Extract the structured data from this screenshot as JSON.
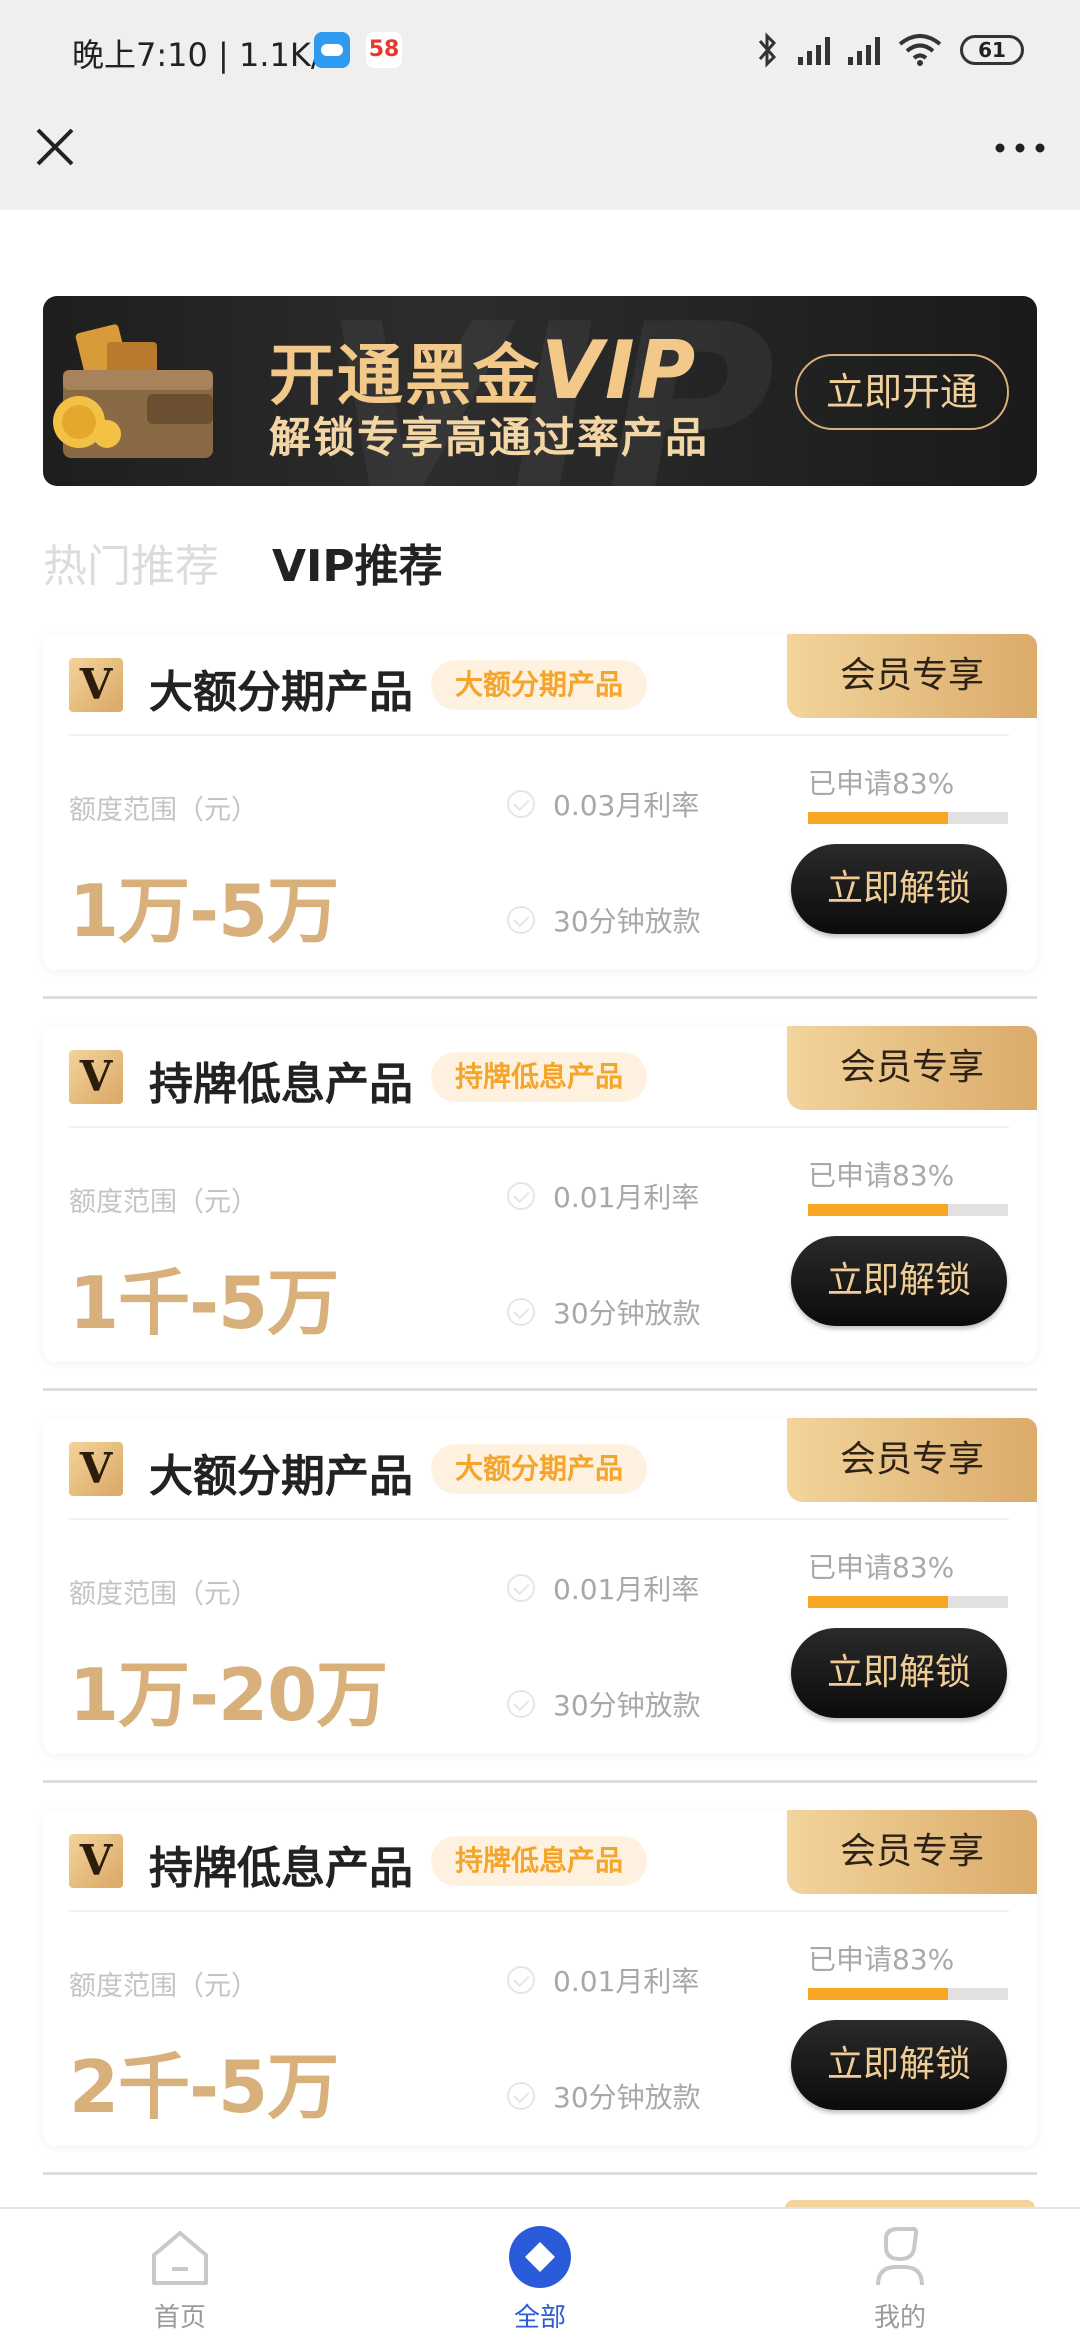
{
  "status_bar": {
    "time_speed": "晚上7:10 | 1.1K/s",
    "app_badge": "58",
    "battery": "61"
  },
  "banner": {
    "title": "开通黑金",
    "title_vip": "VIP",
    "subtitle": "解锁专享高通过率产品",
    "button": "立即开通",
    "watermark": "VIP VIP"
  },
  "tabs": [
    {
      "label": "热门推荐",
      "active": false
    },
    {
      "label": "VIP推荐",
      "active": true
    }
  ],
  "cards": [
    {
      "badge": "V",
      "title": "大额分期产品",
      "tag": "大额分期产品",
      "member": "会员专享",
      "range_label": "额度范围（元）",
      "amount": "1万-5万",
      "rate": "0.03月利率",
      "loan_time": "30分钟放款",
      "applied": "已申请83%",
      "applied_fraction": 0.7,
      "button": "立即解锁"
    },
    {
      "badge": "V",
      "title": "持牌低息产品",
      "tag": "持牌低息产品",
      "member": "会员专享",
      "range_label": "额度范围（元）",
      "amount": "1千-5万",
      "rate": "0.01月利率",
      "loan_time": "30分钟放款",
      "applied": "已申请83%",
      "applied_fraction": 0.7,
      "button": "立即解锁"
    },
    {
      "badge": "V",
      "title": "大额分期产品",
      "tag": "大额分期产品",
      "member": "会员专享",
      "range_label": "额度范围（元）",
      "amount": "1万-20万",
      "rate": "0.01月利率",
      "loan_time": "30分钟放款",
      "applied": "已申请83%",
      "applied_fraction": 0.7,
      "button": "立即解锁"
    },
    {
      "badge": "V",
      "title": "持牌低息产品",
      "tag": "持牌低息产品",
      "member": "会员专享",
      "range_label": "额度范围（元）",
      "amount": "2千-5万",
      "rate": "0.01月利率",
      "loan_time": "30分钟放款",
      "applied": "已申请83%",
      "applied_fraction": 0.7,
      "button": "立即解锁"
    }
  ],
  "bottom_nav": [
    {
      "label": "首页",
      "icon": "home-icon",
      "active": false
    },
    {
      "label": "全部",
      "icon": "all-icon",
      "active": true
    },
    {
      "label": "我的",
      "icon": "profile-icon",
      "active": false
    }
  ],
  "colors": {
    "gold": "#d8b07b",
    "tag_text": "#f4a52c",
    "progress": "#f6a623",
    "nav_active": "#2a5bd8"
  }
}
